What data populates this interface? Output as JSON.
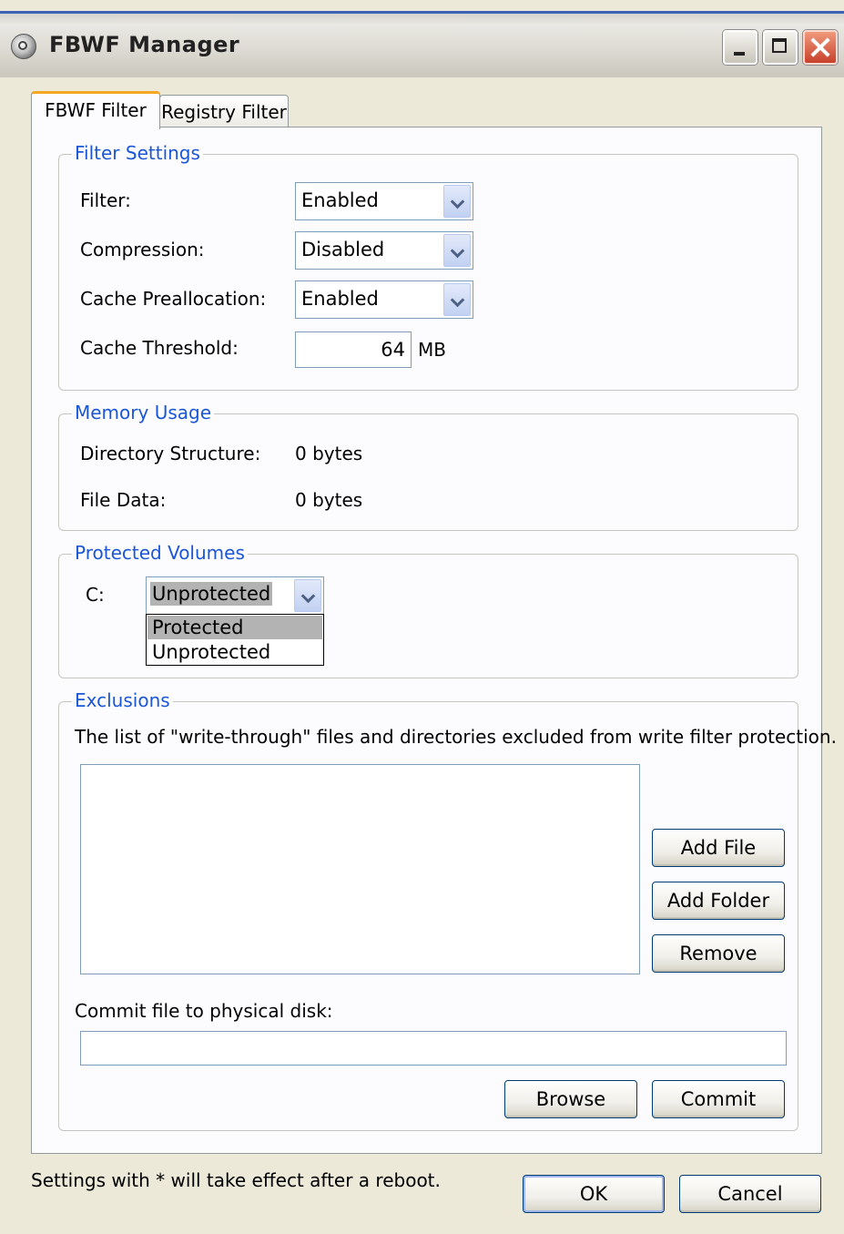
{
  "window": {
    "title": "FBWF Manager"
  },
  "tabs": [
    {
      "label": "FBWF Filter",
      "active": true
    },
    {
      "label": "Registry Filter",
      "active": false
    }
  ],
  "filter_settings": {
    "legend": "Filter Settings",
    "filter_label": "Filter:",
    "filter_value": "Enabled",
    "compression_label": "Compression:",
    "compression_value": "Disabled",
    "cache_prealloc_label": "Cache Preallocation:",
    "cache_prealloc_value": "Enabled",
    "cache_threshold_label": "Cache Threshold:",
    "cache_threshold_value": "64",
    "cache_threshold_unit": "MB"
  },
  "memory_usage": {
    "legend": "Memory Usage",
    "dir_structure_label": "Directory Structure:",
    "dir_structure_value": "0 bytes",
    "file_data_label": "File Data:",
    "file_data_value": "0 bytes"
  },
  "protected_volumes": {
    "legend": "Protected Volumes",
    "volume_label": "C:",
    "selected": "Unprotected",
    "options": [
      "Protected",
      "Unprotected"
    ]
  },
  "exclusions": {
    "legend": "Exclusions",
    "description": "The list of \"write-through\" files and directories excluded from write filter protection.",
    "add_file": "Add File",
    "add_folder": "Add Folder",
    "remove": "Remove",
    "commit_label": "Commit file to physical disk:",
    "commit_path": "",
    "browse": "Browse",
    "commit": "Commit"
  },
  "footer": {
    "note": "Settings with * will take effect after a reboot.",
    "ok": "OK",
    "cancel": "Cancel"
  },
  "colors": {
    "legend_text": "#1a56d6",
    "window_bg": "#ece9d8",
    "panel_bg": "#fcfcfe",
    "tab_accent": "#f5a623"
  }
}
